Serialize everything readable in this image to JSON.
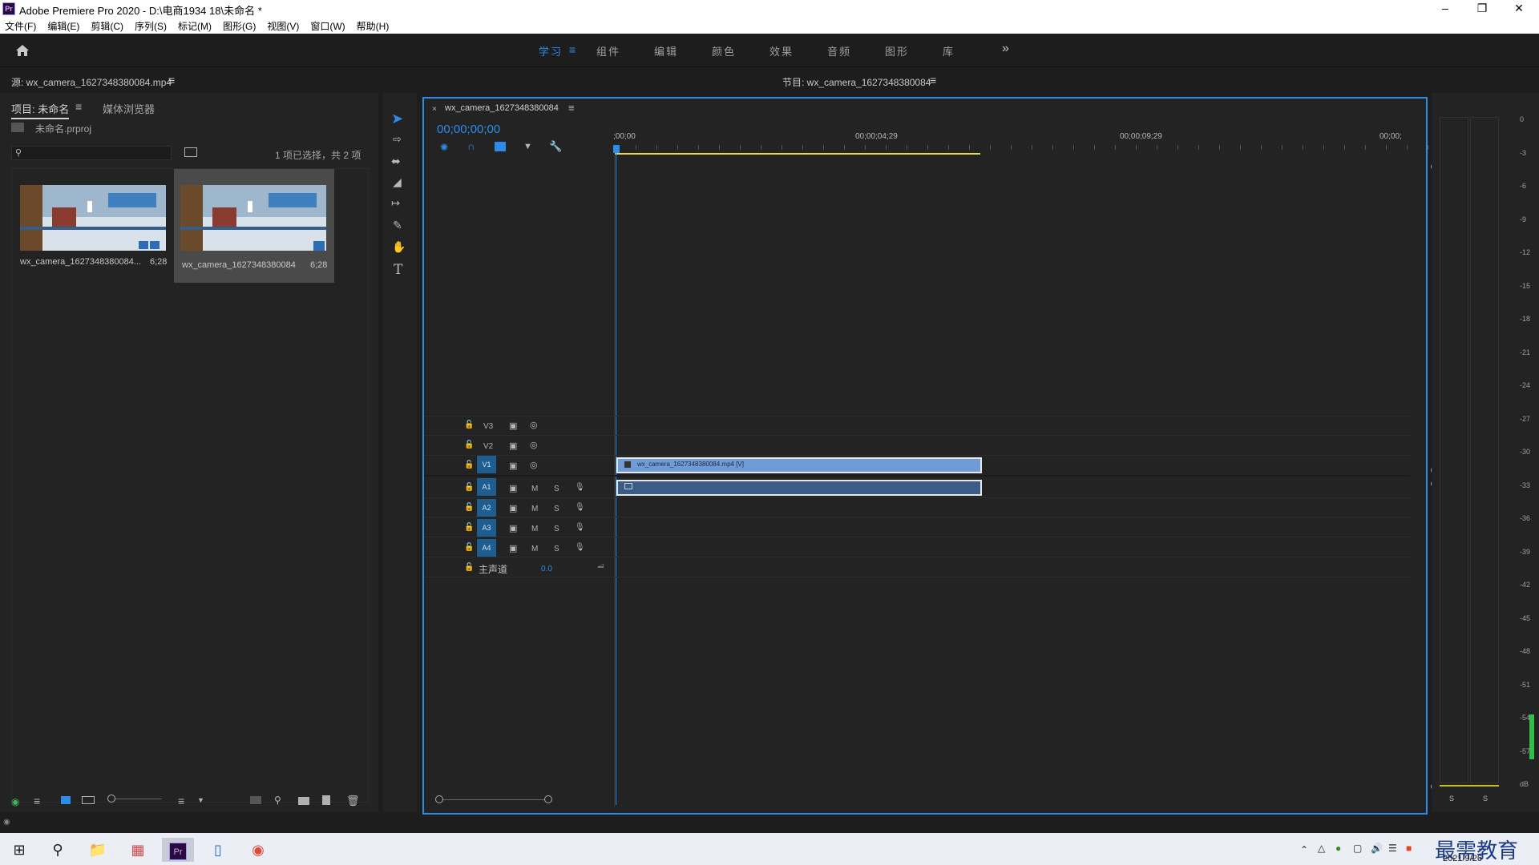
{
  "window": {
    "title": "Adobe Premiere Pro 2020 - D:\\电商1934 18\\未命名 *",
    "app_icon": "Pr"
  },
  "menu": [
    "文件(F)",
    "编辑(E)",
    "剪辑(C)",
    "序列(S)",
    "标记(M)",
    "图形(G)",
    "视图(V)",
    "窗口(W)",
    "帮助(H)"
  ],
  "workspaces": [
    {
      "label": "学习",
      "active": true
    },
    {
      "label": "组件",
      "active": false
    },
    {
      "label": "编辑",
      "active": false
    },
    {
      "label": "颜色",
      "active": false
    },
    {
      "label": "效果",
      "active": false
    },
    {
      "label": "音频",
      "active": false
    },
    {
      "label": "图形",
      "active": false
    },
    {
      "label": "库",
      "active": false
    }
  ],
  "source_panel": {
    "title": "源: wx_camera_1627348380084.mp4"
  },
  "program_panel": {
    "title": "节目: wx_camera_1627348380084"
  },
  "project": {
    "tab_project": "项目: 未命名",
    "tab_media": "媒体浏览器",
    "file": "未命名.prproj",
    "selection_info": "1 项已选择，共 2 项",
    "items": [
      {
        "name": "wx_camera_1627348380084...",
        "duration": "6;28"
      },
      {
        "name": "wx_camera_1627348380084",
        "duration": "6;28"
      }
    ]
  },
  "timeline": {
    "tab": "wx_camera_1627348380084",
    "timecode": "00;00;00;00",
    "ruler": [
      ";00;00",
      "00;00;04;29",
      "00;00;09;29",
      "00;00;"
    ],
    "video_tracks": [
      "V3",
      "V2",
      "V1"
    ],
    "audio_tracks": [
      "A1",
      "A2",
      "A3",
      "A4"
    ],
    "master_label": "主声道",
    "master_value": "0.0",
    "video_clip": "wx_camera_1627348380084.mp4 [V]"
  },
  "meters": {
    "scale": [
      "0",
      "-3",
      "-6",
      "-9",
      "-12",
      "-15",
      "-18",
      "-21",
      "-24",
      "-27",
      "-30",
      "-33",
      "-36",
      "-39",
      "-42",
      "-45",
      "-48",
      "-51",
      "-54",
      "-57",
      "dB"
    ],
    "solo_a": "S",
    "solo_b": "S"
  },
  "taskbar": {
    "date": "2021/9/26",
    "watermark": "最需教育"
  },
  "colors": {
    "accent": "#2d8ceb",
    "clip_video": "#6f9bd6",
    "clip_audio": "#3a5c87",
    "playhead_yellow": "#e6d84a"
  }
}
